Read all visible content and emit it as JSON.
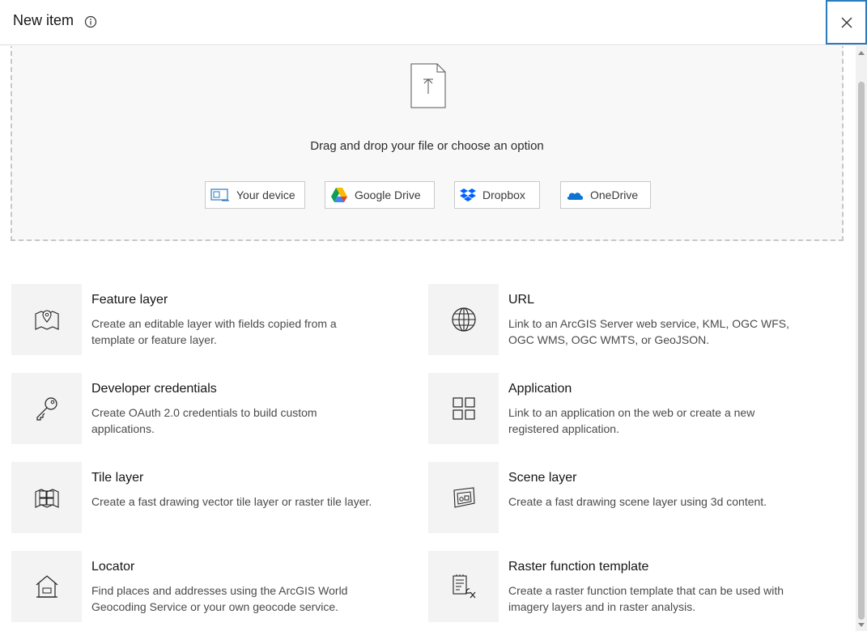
{
  "header": {
    "title": "New item"
  },
  "dropzone": {
    "text": "Drag and drop your file or choose an option",
    "sources": [
      {
        "label": "Your device",
        "icon": "monitor-icon"
      },
      {
        "label": "Google Drive",
        "icon": "google-drive-icon"
      },
      {
        "label": "Dropbox",
        "icon": "dropbox-icon"
      },
      {
        "label": "OneDrive",
        "icon": "onedrive-icon"
      }
    ]
  },
  "items": [
    {
      "title": "Feature layer",
      "desc": "Create an editable layer with fields copied from a template or feature layer.",
      "icon": "map-pin-icon"
    },
    {
      "title": "URL",
      "desc": "Link to an ArcGIS Server web service, KML, OGC WFS, OGC WMS, OGC WMTS, or GeoJSON.",
      "icon": "globe-icon"
    },
    {
      "title": "Developer credentials",
      "desc": "Create OAuth 2.0 credentials to build custom applications.",
      "icon": "key-icon"
    },
    {
      "title": "Application",
      "desc": "Link to an application on the web or create a new registered application.",
      "icon": "grid-icon"
    },
    {
      "title": "Tile layer",
      "desc": "Create a fast drawing vector tile layer or raster tile layer.",
      "icon": "tile-layer-icon"
    },
    {
      "title": "Scene layer",
      "desc": "Create a fast drawing scene layer using 3d content.",
      "icon": "scene-layer-icon"
    },
    {
      "title": "Locator",
      "desc": "Find places and addresses using the ArcGIS World Geocoding Service or your own geocode service.",
      "icon": "house-icon"
    },
    {
      "title": "Raster function template",
      "desc": "Create a raster function template that can be used with imagery layers and in raster analysis.",
      "icon": "raster-function-icon"
    }
  ],
  "colors": {
    "accent": "#2b7bbf",
    "icon_bg": "#f3f3f3",
    "dropzone_bg": "#f8f8f8"
  }
}
